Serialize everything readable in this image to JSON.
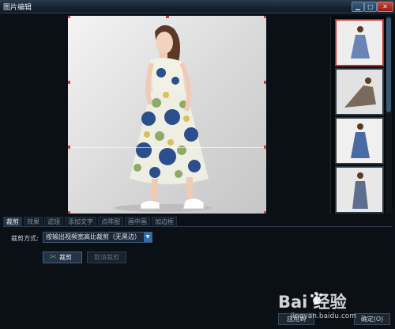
{
  "window": {
    "title": "图片编辑",
    "min_glyph": "▁",
    "max_glyph": "□",
    "close_glyph": "✕"
  },
  "thumbnails": {
    "count": 4,
    "selected_index": 0
  },
  "tabs": [
    {
      "label": "裁剪",
      "active": true
    },
    {
      "label": "效果",
      "active": false
    },
    {
      "label": "滤镜",
      "active": false
    },
    {
      "label": "添加文字",
      "active": false
    },
    {
      "label": "点阵图",
      "active": false
    },
    {
      "label": "画中画",
      "active": false
    },
    {
      "label": "加边框",
      "active": false
    }
  ],
  "crop": {
    "mode_label": "裁剪方式:",
    "mode_value": "按输出视频宽高比裁剪（无黑边）",
    "crop_button": "裁剪",
    "cancel_button": "取消裁剪"
  },
  "footer": {
    "apply_button": "应用到",
    "ok_button": "确定(O)"
  },
  "watermark": {
    "text": "Bai 经验",
    "sub": "jingyan.baidu.com"
  },
  "colors": {
    "accent_red": "#c82626",
    "select_arrow": "#2f6ea8",
    "scissors": "#39b54a"
  },
  "icons": [
    "minimize-icon",
    "maximize-icon",
    "close-icon",
    "scissors-icon",
    "dropdown-arrow-icon",
    "paw-logo-icon"
  ]
}
